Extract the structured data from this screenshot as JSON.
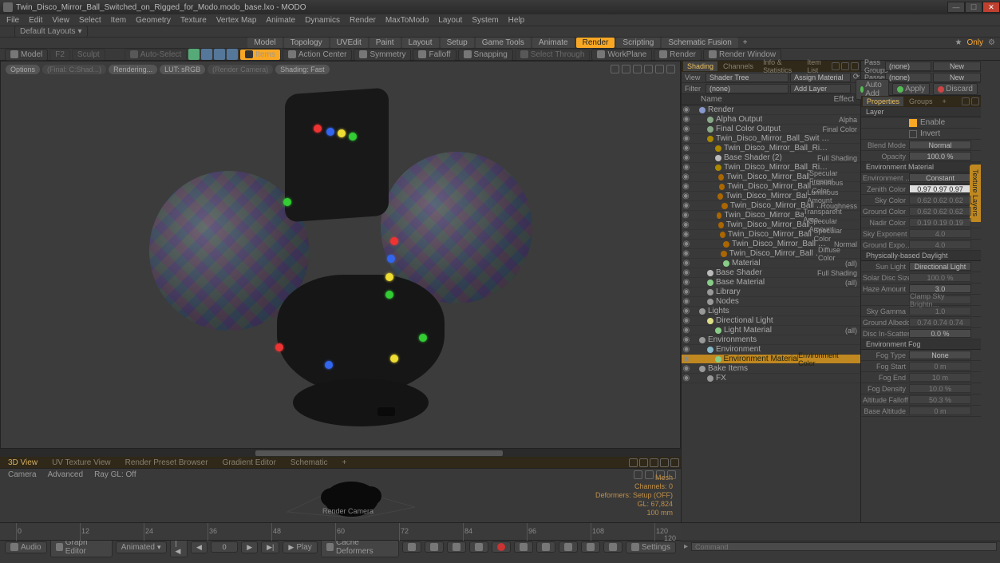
{
  "title": "Twin_Disco_Mirror_Ball_Switched_on_Rigged_for_Modo.modo_base.lxo - MODO",
  "menus": [
    "File",
    "Edit",
    "View",
    "Select",
    "Item",
    "Geometry",
    "Texture",
    "Vertex Map",
    "Animate",
    "Dynamics",
    "Render",
    "MaxToModo",
    "Layout",
    "System",
    "Help"
  ],
  "default_layouts": "Default Layouts",
  "layout_tabs": [
    "Model",
    "Topology",
    "UVEdit",
    "Paint",
    "Layout",
    "Setup",
    "Game Tools",
    "Animate",
    "Render",
    "Scripting",
    "Schematic Fusion"
  ],
  "layout_active": "Render",
  "only": "Only",
  "toolbar": {
    "model": "Model",
    "sculpt": "Sculpt",
    "autoselect": "Auto-Select",
    "items": "Items",
    "action_center": "Action Center",
    "symmetry": "Symmetry",
    "falloff": "Falloff",
    "snapping": "Snapping",
    "select_through": "Select Through",
    "workplane": "WorkPlane",
    "render": "Render",
    "render_window": "Render Window"
  },
  "vp_chips": [
    "Options",
    "(Final: C:Shad...)",
    "Rendering...",
    "LUT: sRGB",
    "(Render Camera)",
    "Shading: Fast"
  ],
  "subtabs": [
    "3D View",
    "UV Texture View",
    "Render Preset Browser",
    "Gradient Editor",
    "Schematic"
  ],
  "subtab_active": "3D View",
  "cam_row": [
    "Camera",
    "Advanced",
    "Ray GL: Off"
  ],
  "cam_label": "Render Camera",
  "cam_info": [
    "Mesh",
    "Channels: 0",
    "Deformers: Setup (OFF)",
    "GL: 67,824",
    "100 mm"
  ],
  "mid_tabs": [
    "Shading",
    "Channels",
    "Info & Statistics",
    "Item List"
  ],
  "mid_tab_active": "Shading",
  "mid_rows": {
    "view_lbl": "View",
    "view_val": "Shader Tree",
    "assign": "Assign Material",
    "filter_lbl": "Filter",
    "filter_val": "(none)",
    "addlayer": "Add Layer"
  },
  "tree_hdr": {
    "name": "Name",
    "effect": "Effect"
  },
  "tree": [
    {
      "ind": 1,
      "nm": "Render",
      "ef": "",
      "dot": "#89c"
    },
    {
      "ind": 2,
      "nm": "Alpha Output",
      "ef": "Alpha",
      "dot": "#8a8"
    },
    {
      "ind": 2,
      "nm": "Final Color Output",
      "ef": "Final Color",
      "dot": "#8a8"
    },
    {
      "ind": 2,
      "nm": "Twin_Disco_Mirror_Ball_Swit …",
      "ef": "",
      "dot": "#a80"
    },
    {
      "ind": 3,
      "nm": "Twin_Disco_Mirror_Ball_Ri…",
      "ef": "",
      "dot": "#a80"
    },
    {
      "ind": 3,
      "nm": "Base Shader (2)",
      "ef": "Full Shading",
      "dot": "#bbb"
    },
    {
      "ind": 3,
      "nm": "Twin_Disco_Mirror_Ball_Ri…",
      "ef": "",
      "dot": "#a80"
    },
    {
      "ind": 4,
      "nm": "Twin_Disco_Mirror_Ball …",
      "ef": "Specular Fresnel",
      "dot": "#a60"
    },
    {
      "ind": 4,
      "nm": "Twin_Disco_Mirror_Ball …",
      "ef": "Luminous Color",
      "dot": "#a60"
    },
    {
      "ind": 4,
      "nm": "Twin_Disco_Mirror_Ball …",
      "ef": "Luminous Amount",
      "dot": "#a60"
    },
    {
      "ind": 4,
      "nm": "Twin_Disco_Mirror_Ball …",
      "ef": "Roughness",
      "dot": "#a60"
    },
    {
      "ind": 4,
      "nm": "Twin_Disco_Mirror_Ball …",
      "ef": "Transparent Amo …",
      "dot": "#a60"
    },
    {
      "ind": 4,
      "nm": "Twin_Disco_Mirror_Ball …",
      "ef": "Specular Amount",
      "dot": "#a60"
    },
    {
      "ind": 4,
      "nm": "Twin_Disco_Mirror_Ball …",
      "ef": "Specular Color",
      "dot": "#a60"
    },
    {
      "ind": 4,
      "nm": "Twin_Disco_Mirror_Ball …",
      "ef": "Normal",
      "dot": "#a60"
    },
    {
      "ind": 4,
      "nm": "Twin_Disco_Mirror_Ball …",
      "ef": "Diffuse Color",
      "dot": "#a60"
    },
    {
      "ind": 4,
      "nm": "Material",
      "ef": "(all)",
      "dot": "#8c8"
    },
    {
      "ind": 2,
      "nm": "Base Shader",
      "ef": "Full Shading",
      "dot": "#bbb"
    },
    {
      "ind": 2,
      "nm": "Base Material",
      "ef": "(all)",
      "dot": "#8c8"
    },
    {
      "ind": 2,
      "nm": "Library",
      "ef": "",
      "dot": "#999"
    },
    {
      "ind": 2,
      "nm": "Nodes",
      "ef": "",
      "dot": "#999"
    },
    {
      "ind": 1,
      "nm": "Lights",
      "ef": "",
      "dot": "#999"
    },
    {
      "ind": 2,
      "nm": "Directional Light",
      "ef": "",
      "dot": "#dd8"
    },
    {
      "ind": 3,
      "nm": "Light Material",
      "ef": "(all)",
      "dot": "#8c8"
    },
    {
      "ind": 1,
      "nm": "Environments",
      "ef": "",
      "dot": "#999"
    },
    {
      "ind": 2,
      "nm": "Environment",
      "ef": "",
      "dot": "#8bc"
    },
    {
      "ind": 3,
      "nm": "Environment Material",
      "ef": "Environment Color",
      "dot": "#8c8",
      "sel": true
    },
    {
      "ind": 1,
      "nm": "Bake Items",
      "ef": "",
      "dot": "#999"
    },
    {
      "ind": 2,
      "nm": "FX",
      "ef": "",
      "dot": "#999"
    }
  ],
  "passes": {
    "pg_lbl": "Pass Groups",
    "pg_val": "(none)",
    "pg_new": "New",
    "p_lbl": "Passes",
    "p_val": "(none)",
    "p_new": "New"
  },
  "autoadd": {
    "auto": "Auto Add",
    "apply": "Apply",
    "discard": "Discard"
  },
  "prop_tabs": [
    "Properties",
    "Groups"
  ],
  "prop_tab_active": "Properties",
  "vtab": "Texture Layers",
  "layer_hdr": "Layer",
  "enable": "Enable",
  "invert": "Invert",
  "props": [
    {
      "lbl": "Blend Mode",
      "val": "Normal"
    },
    {
      "lbl": "Opacity",
      "val": "100.0 %"
    }
  ],
  "envmat_hdr": "Environment Material",
  "envmat": [
    {
      "lbl": "Environment …",
      "val": "Constant"
    },
    {
      "lbl": "Zenith Color",
      "val": "0.97   0.97   0.97",
      "white": true
    },
    {
      "lbl": "Sky Color",
      "val": "0.62   0.62   0.62",
      "dim": true
    },
    {
      "lbl": "Ground Color",
      "val": "0.62   0.62   0.62",
      "dim": true
    },
    {
      "lbl": "Nadir Color",
      "val": "0.19   0.19   0.19",
      "dim": true
    },
    {
      "lbl": "Sky Exponent",
      "val": "4.0",
      "dim": true
    },
    {
      "lbl": "Ground Expo…",
      "val": "4.0",
      "dim": true
    }
  ],
  "daylight_hdr": "Physically-based Daylight",
  "daylight": [
    {
      "lbl": "Sun Light",
      "val": "Directional Light"
    },
    {
      "lbl": "Solar Disc Size",
      "val": "100.0 %",
      "dim": true
    },
    {
      "lbl": "Haze Amount",
      "val": "3.0"
    },
    {
      "lbl": "",
      "val": "Clamp Sky Brightn…",
      "dim": true
    },
    {
      "lbl": "Sky Gamma",
      "val": "1.0",
      "dim": true
    },
    {
      "lbl": "Ground Albedo",
      "val": "0.74   0.74   0.74",
      "dim": true
    },
    {
      "lbl": "Disc In-Scatter",
      "val": "0.0 %"
    }
  ],
  "fog_hdr": "Environment Fog",
  "fog": [
    {
      "lbl": "Fog Type",
      "val": "None"
    },
    {
      "lbl": "Fog Start",
      "val": "0 m",
      "dim": true
    },
    {
      "lbl": "Fog End",
      "val": "10 m",
      "dim": true
    },
    {
      "lbl": "Fog Density",
      "val": "10.0 %",
      "dim": true
    },
    {
      "lbl": "Altitude Falloff",
      "val": "50.3 %",
      "dim": true
    },
    {
      "lbl": "Base Altitude",
      "val": "0 m",
      "dim": true
    }
  ],
  "command_ph": "Command",
  "timeline_ticks": [
    0,
    12,
    24,
    36,
    48,
    60,
    72,
    84,
    96,
    108,
    120
  ],
  "timeline_end": "120",
  "bottombar": {
    "audio": "Audio",
    "graph": "Graph Editor",
    "animated": "Animated",
    "frame": "0",
    "play": "Play",
    "cache": "Cache Deformers",
    "settings": "Settings"
  }
}
